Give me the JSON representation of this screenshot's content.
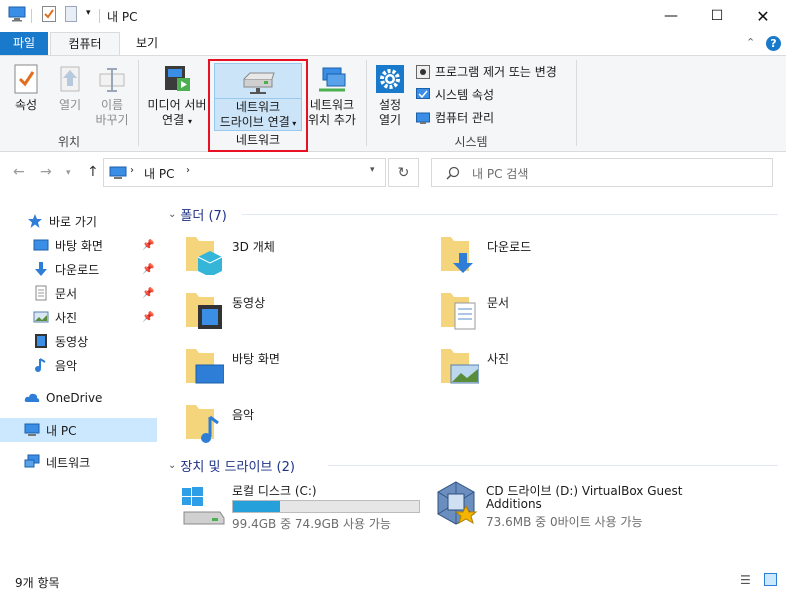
{
  "window": {
    "title": "내 PC"
  },
  "tabs": {
    "file": "파일",
    "computer": "컴퓨터",
    "view": "보기"
  },
  "ribbon": {
    "location": {
      "properties": "속성",
      "open": "열기",
      "rename_1": "이름",
      "rename_2": "바꾸기",
      "group": "위치"
    },
    "network": {
      "media_1": "미디어 서버",
      "media_2": "연결",
      "map_drive_1": "네트워크",
      "map_drive_2": "드라이브 연결",
      "add_loc_1": "네트워크",
      "add_loc_2": "위치 추가",
      "group": "네트워크"
    },
    "system": {
      "settings_1": "설정",
      "settings_2": "열기",
      "uninstall": "프로그램 제거 또는 변경",
      "sys_props": "시스템 속성",
      "manage": "컴퓨터 관리",
      "group": "시스템"
    },
    "highlight_color": "#e81123"
  },
  "address": {
    "path": "내 PC",
    "search_placeholder": "내 PC 검색"
  },
  "sidebar": {
    "quick_access": "바로 가기",
    "items": [
      "바탕 화면",
      "다운로드",
      "문서",
      "사진",
      "동영상",
      "음악"
    ],
    "onedrive": "OneDrive",
    "this_pc": "내 PC",
    "network": "네트워크"
  },
  "folders_section": {
    "title": "폴더 (7)",
    "items": [
      "3D 개체",
      "다운로드",
      "동영상",
      "문서",
      "바탕 화면",
      "사진",
      "음악"
    ]
  },
  "drives_section": {
    "title": "장치 및 드라이브 (2)",
    "drives": [
      {
        "name": "로컬 디스크 (C:)",
        "space": "99.4GB 중 74.9GB 사용 가능",
        "used_fraction": 0.25
      },
      {
        "name_1": "CD 드라이브 (D:) VirtualBox Guest",
        "name_2": "Additions",
        "space": "73.6MB 중 0바이트 사용 가능"
      }
    ]
  },
  "status": {
    "count": "9개 항목"
  },
  "colors": {
    "accent": "#1979ca",
    "section_text": "#1e3287",
    "drive_bar": "#26a0da"
  }
}
